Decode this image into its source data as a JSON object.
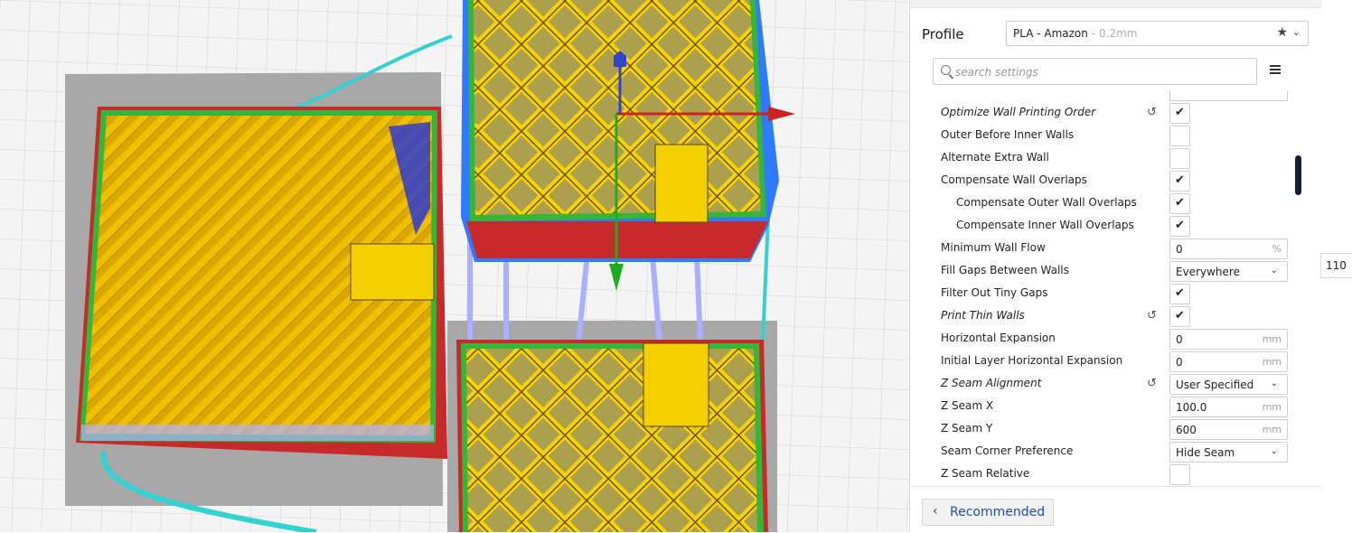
{
  "colors": {
    "accent": "#1e4cb0",
    "infill": "#f5c400",
    "wall_outer": "#c62a2a",
    "wall_inner": "#35b53a",
    "skin": "#2233dd",
    "travel": "#9aa0ff",
    "support": "#35d0d0",
    "axis_x": "#cc2222",
    "axis_y": "#22aa22",
    "axis_z": "#3344cc"
  },
  "profile": {
    "label": "Profile",
    "name": "PLA - Amazon",
    "sub": "- 0.2mm",
    "star_icon": "star-icon",
    "chevron_icon": "chevron-down-icon"
  },
  "search": {
    "placeholder": "search settings",
    "value": ""
  },
  "menu_icon": "hamburger-icon",
  "settings": [
    {
      "label": "Optimize Wall Printing Order",
      "italic": true,
      "reset": true,
      "type": "checkbox",
      "checked": true
    },
    {
      "label": "Outer Before Inner Walls",
      "type": "checkbox",
      "checked": false
    },
    {
      "label": "Alternate Extra Wall",
      "type": "checkbox",
      "checked": false
    },
    {
      "label": "Compensate Wall Overlaps",
      "type": "checkbox",
      "checked": true
    },
    {
      "label": "Compensate Outer Wall Overlaps",
      "sub": true,
      "type": "checkbox",
      "checked": true
    },
    {
      "label": "Compensate Inner Wall Overlaps",
      "sub": true,
      "type": "checkbox",
      "checked": true
    },
    {
      "label": "Minimum Wall Flow",
      "type": "field",
      "value": "0",
      "unit": "%"
    },
    {
      "label": "Fill Gaps Between Walls",
      "type": "dropdown",
      "value": "Everywhere"
    },
    {
      "label": "Filter Out Tiny Gaps",
      "type": "checkbox",
      "checked": true
    },
    {
      "label": "Print Thin Walls",
      "italic": true,
      "reset": true,
      "type": "checkbox",
      "checked": true
    },
    {
      "label": "Horizontal Expansion",
      "type": "field",
      "value": "0",
      "unit": "mm"
    },
    {
      "label": "Initial Layer Horizontal Expansion",
      "type": "field",
      "value": "0",
      "unit": "mm"
    },
    {
      "label": "Z Seam Alignment",
      "italic": true,
      "reset": true,
      "type": "dropdown",
      "value": "User Specified"
    },
    {
      "label": "Z Seam X",
      "type": "field",
      "value": "100.0",
      "unit": "mm"
    },
    {
      "label": "Z Seam Y",
      "type": "field",
      "value": "600",
      "unit": "mm"
    },
    {
      "label": "Seam Corner Preference",
      "type": "dropdown",
      "value": "Hide Seam"
    },
    {
      "label": "Z Seam Relative",
      "type": "checkbox",
      "checked": false
    }
  ],
  "bottom": {
    "recommended_label": "Recommended"
  },
  "side_value": "110"
}
